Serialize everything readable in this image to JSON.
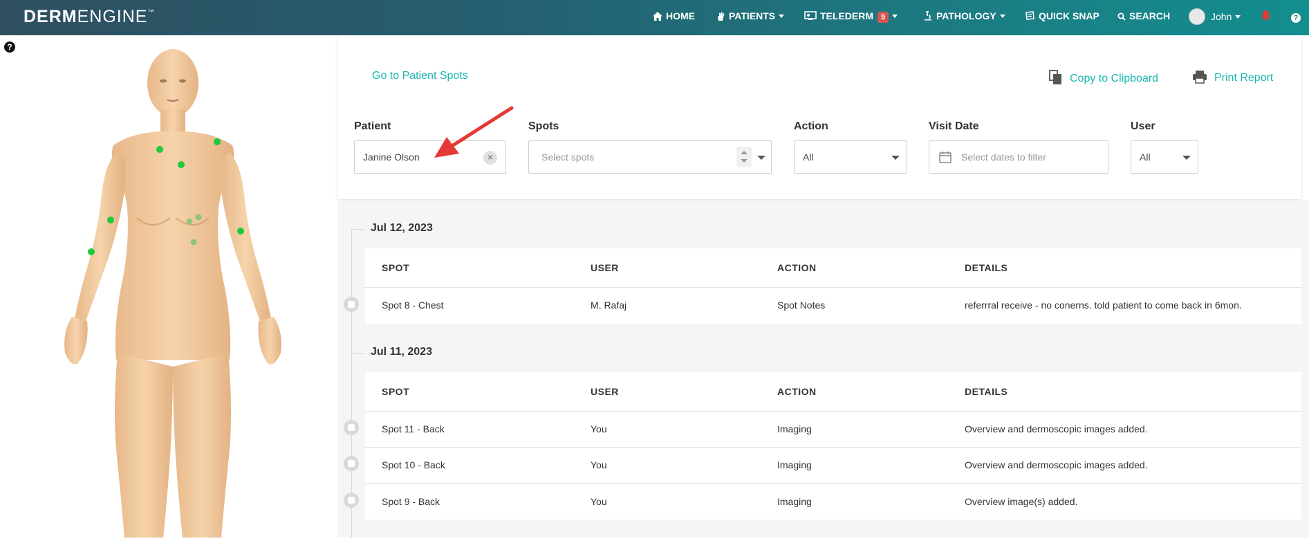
{
  "brand": {
    "bold": "DERM",
    "light": "ENGINE",
    "tm": "™"
  },
  "nav": {
    "home": "HOME",
    "patients": "PATIENTS",
    "telederm": "TELEDERM",
    "telederm_badge": "9",
    "pathology": "PATHOLOGY",
    "quick_snap": "QUICK SNAP",
    "search": "SEARCH",
    "user": "John"
  },
  "help_glyph": "?",
  "actions": {
    "go_to_spots": "Go to Patient Spots",
    "copy": "Copy to Clipboard",
    "print": "Print Report"
  },
  "filters": {
    "patient_label": "Patient",
    "patient_value": "Janine Olson",
    "spots_label": "Spots",
    "spots_placeholder": "Select spots",
    "action_label": "Action",
    "action_value": "All",
    "visit_label": "Visit Date",
    "visit_placeholder": "Select dates to filter",
    "user_label": "User",
    "user_value": "All"
  },
  "table_headers": {
    "spot": "SPOT",
    "user": "USER",
    "action": "ACTION",
    "details": "DETAILS"
  },
  "groups": [
    {
      "date": "Jul 12, 2023",
      "rows": [
        {
          "spot": "Spot 8 - Chest",
          "user": "M. Rafaj",
          "action": "Spot Notes",
          "details": "referrral receive - no conerns. told patient to come back in 6mon."
        }
      ]
    },
    {
      "date": "Jul 11, 2023",
      "rows": [
        {
          "spot": "Spot 11 - Back",
          "user": "You",
          "action": "Imaging",
          "details": "Overview and dermoscopic images added."
        },
        {
          "spot": "Spot 10 - Back",
          "user": "You",
          "action": "Imaging",
          "details": "Overview and dermoscopic images added."
        },
        {
          "spot": "Spot 9 - Back",
          "user": "You",
          "action": "Imaging",
          "details": "Overview image(s) added."
        }
      ]
    }
  ],
  "colors": {
    "accent": "#17b6b0",
    "badge": "#d9534f",
    "spot_dot": "#1ec93c",
    "annotation_arrow": "#e53935"
  }
}
